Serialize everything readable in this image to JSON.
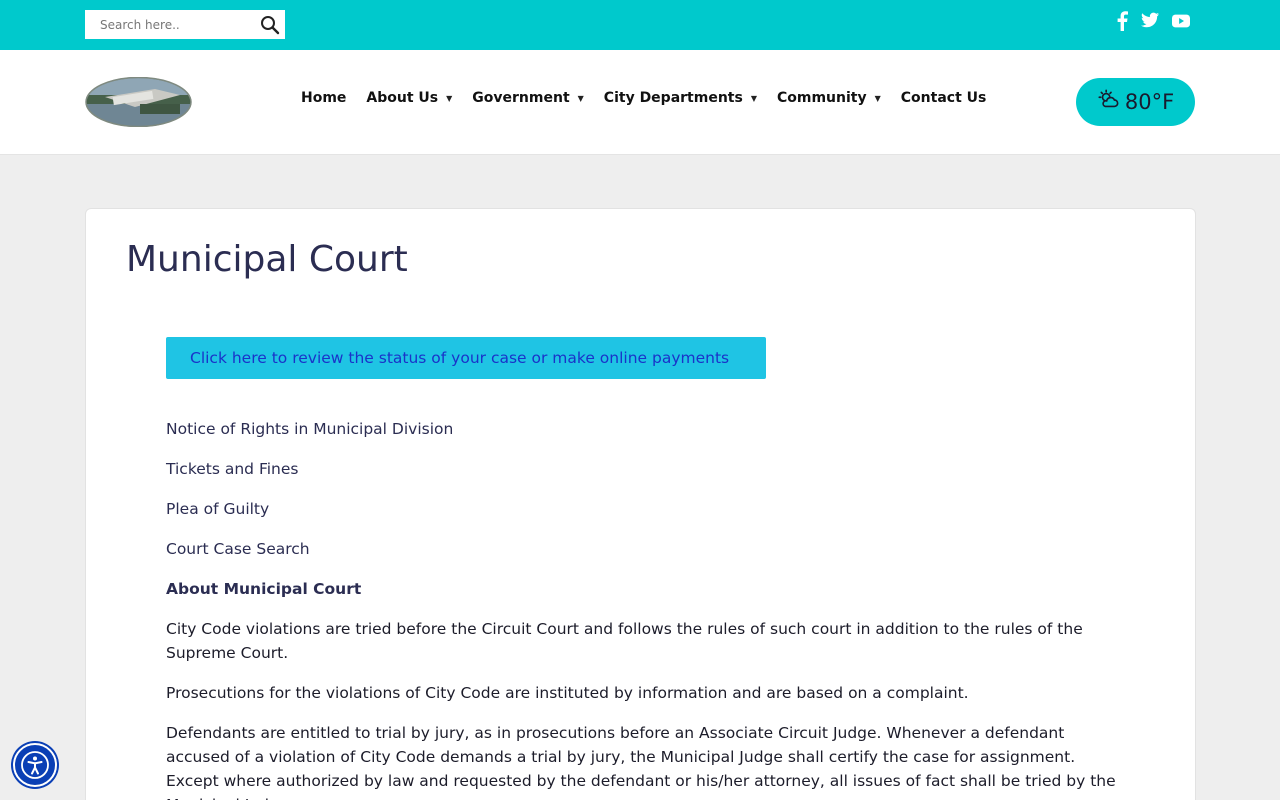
{
  "topbar": {
    "search_placeholder": "Search here..",
    "colors": {
      "bar": "#00c9cc"
    },
    "social": [
      "facebook-icon",
      "twitter-icon",
      "youtube-icon"
    ]
  },
  "header": {
    "nav": [
      {
        "label": "Home",
        "dropdown": false
      },
      {
        "label": "About Us",
        "dropdown": true
      },
      {
        "label": "Government",
        "dropdown": true
      },
      {
        "label": "City Departments",
        "dropdown": true
      },
      {
        "label": "Community",
        "dropdown": true
      },
      {
        "label": "Contact Us",
        "dropdown": false
      }
    ],
    "weather": {
      "icon": "partly-sunny-icon",
      "temp": "80°F"
    }
  },
  "main": {
    "title": "Municipal Court",
    "cta_label": "Click here to review the status of your case or make online payments",
    "links": [
      "Notice of Rights in Municipal Division",
      "Tickets and Fines",
      "Plea of Guilty",
      "Court Case Search"
    ],
    "subheading": "About Municipal Court",
    "paragraphs": [
      "City Code violations are tried before the Circuit Court and follows the rules of such court in addition to the rules of the Supreme Court.",
      "Prosecutions for the violations of City Code are instituted by information and are based on a complaint.",
      "Defendants are entitled to trial by jury, as in prosecutions before an Associate Circuit Judge. Whenever a defendant accused of a violation of City Code demands a trial by jury, the Municipal Judge shall certify the case for assignment. Except where authorized by law and requested by the defendant or his/her attorney, all issues of fact shall be tried by the Municipal Judge."
    ]
  },
  "accessibility": {
    "icon": "accessibility-icon"
  }
}
